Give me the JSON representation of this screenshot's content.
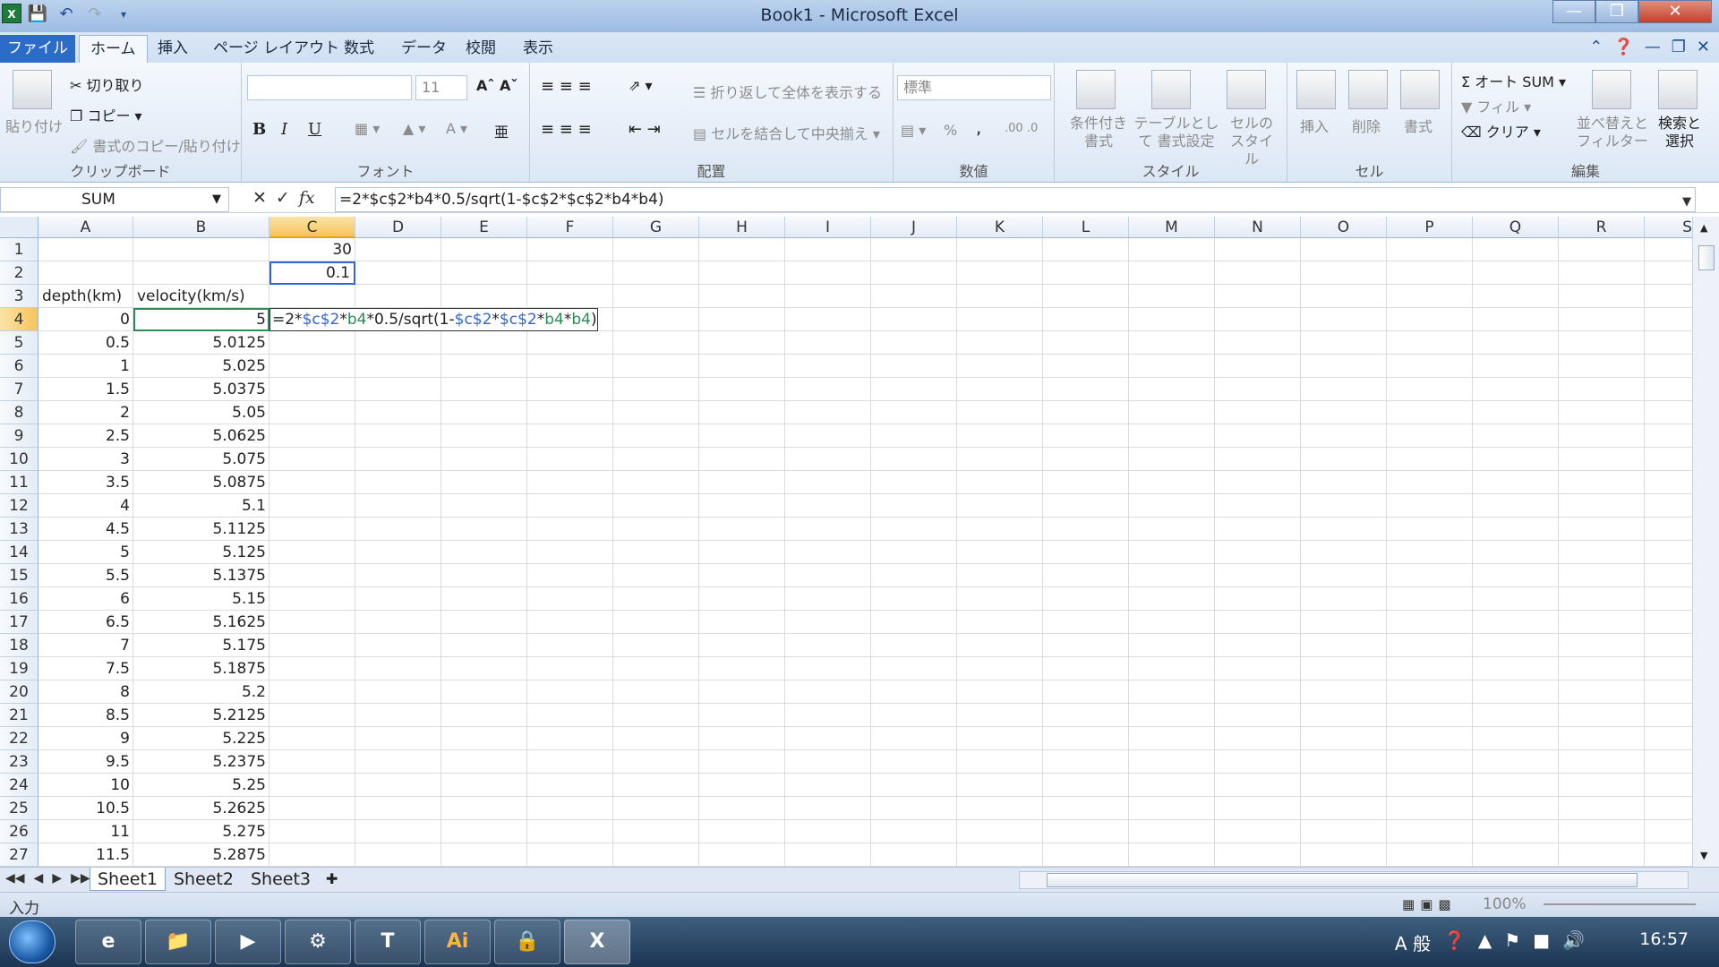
{
  "window": {
    "title": "Book1 - Microsoft Excel",
    "icon": "excel-icon",
    "controls": [
      "minimize-icon",
      "restore-icon",
      "close-icon"
    ]
  },
  "ribbon_tabs": [
    "ファイル",
    "ホーム",
    "挿入",
    "ページ レイアウト",
    "数式",
    "データ",
    "校閲",
    "表示"
  ],
  "ribbon": {
    "clipboard": {
      "paste": "貼り付け",
      "cut": "切り取り",
      "copy": "コピー",
      "format_painter": "書式のコピー/貼り付け",
      "label": "クリップボード"
    },
    "font": {
      "size": "11",
      "bold": "B",
      "italic": "I",
      "underline": "U",
      "label": "フォント"
    },
    "alignment": {
      "wrap": "折り返して全体を表示する",
      "merge": "セルを結合して中央揃え",
      "label": "配置"
    },
    "number": {
      "format": "標準",
      "percent": "%",
      "comma": ",",
      "label": "数値"
    },
    "styles": {
      "cond": "条件付き 書式",
      "table": "テーブルとして 書式設定",
      "cell": "セルの スタイル",
      "label": "スタイル"
    },
    "cells": {
      "insert": "挿入",
      "delete": "削除",
      "format": "書式",
      "label": "セル"
    },
    "editing": {
      "autosum": "Σ オート SUM",
      "fill": "フィル",
      "clear": "クリア",
      "sort": "並べ替えと フィルター",
      "find": "検索と 選択",
      "label": "編集"
    }
  },
  "formula_bar": {
    "name_box": "SUM",
    "formula": "=2*$c$2*b4*0.5/sqrt(1-$c$2*$c$2*b4*b4)"
  },
  "columns": [
    "A",
    "B",
    "C",
    "D",
    "E",
    "F",
    "G",
    "H",
    "I",
    "J",
    "K",
    "L",
    "M",
    "N",
    "O",
    "P",
    "Q",
    "R",
    "S"
  ],
  "cells": {
    "C1": "30",
    "C2": "0.1",
    "A3": "depth(km)",
    "B3": "velocity(km/s)"
  },
  "rows": [
    {
      "n": "1",
      "a": "",
      "b": ""
    },
    {
      "n": "2",
      "a": "",
      "b": ""
    },
    {
      "n": "3",
      "a": "",
      "b": ""
    },
    {
      "n": "4",
      "a": "0",
      "b": "5"
    },
    {
      "n": "5",
      "a": "0.5",
      "b": "5.0125"
    },
    {
      "n": "6",
      "a": "1",
      "b": "5.025"
    },
    {
      "n": "7",
      "a": "1.5",
      "b": "5.0375"
    },
    {
      "n": "8",
      "a": "2",
      "b": "5.05"
    },
    {
      "n": "9",
      "a": "2.5",
      "b": "5.0625"
    },
    {
      "n": "10",
      "a": "3",
      "b": "5.075"
    },
    {
      "n": "11",
      "a": "3.5",
      "b": "5.0875"
    },
    {
      "n": "12",
      "a": "4",
      "b": "5.1"
    },
    {
      "n": "13",
      "a": "4.5",
      "b": "5.1125"
    },
    {
      "n": "14",
      "a": "5",
      "b": "5.125"
    },
    {
      "n": "15",
      "a": "5.5",
      "b": "5.1375"
    },
    {
      "n": "16",
      "a": "6",
      "b": "5.15"
    },
    {
      "n": "17",
      "a": "6.5",
      "b": "5.1625"
    },
    {
      "n": "18",
      "a": "7",
      "b": "5.175"
    },
    {
      "n": "19",
      "a": "7.5",
      "b": "5.1875"
    },
    {
      "n": "20",
      "a": "8",
      "b": "5.2"
    },
    {
      "n": "21",
      "a": "8.5",
      "b": "5.2125"
    },
    {
      "n": "22",
      "a": "9",
      "b": "5.225"
    },
    {
      "n": "23",
      "a": "9.5",
      "b": "5.2375"
    },
    {
      "n": "24",
      "a": "10",
      "b": "5.25"
    },
    {
      "n": "25",
      "a": "10.5",
      "b": "5.2625"
    },
    {
      "n": "26",
      "a": "11",
      "b": "5.275"
    },
    {
      "n": "27",
      "a": "11.5",
      "b": "5.2875"
    }
  ],
  "edit_parts": [
    "=2*",
    "$c$2",
    "*",
    "b4",
    "*0.5/sqrt(1-",
    "$c$2",
    "*",
    "$c$2",
    "*",
    "b4",
    "*",
    "b4",
    ")"
  ],
  "sheets": [
    "Sheet1",
    "Sheet2",
    "Sheet3"
  ],
  "status": {
    "mode": "入力",
    "zoom": "100%"
  },
  "taskbar": {
    "clock": "16:57",
    "ime": "A 般"
  }
}
